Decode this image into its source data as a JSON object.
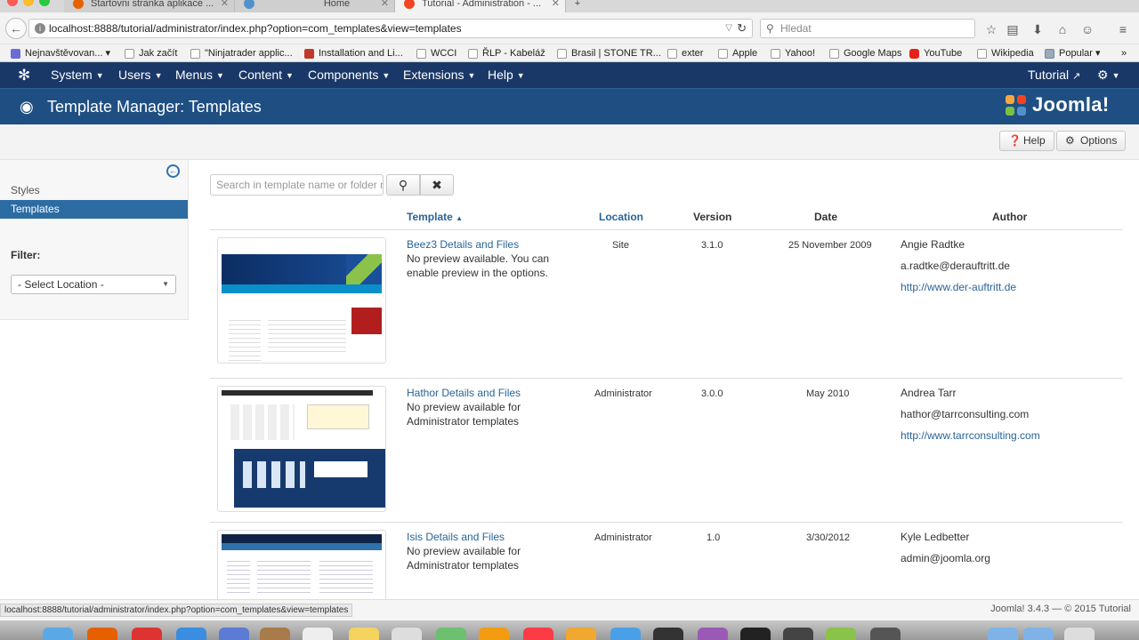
{
  "browser": {
    "tabs": [
      {
        "label": "Startovni stranka aplikace ...",
        "active": false
      },
      {
        "label": "Home",
        "active": false
      },
      {
        "label": "Tutorial - Administration - ...",
        "active": true
      }
    ],
    "url": "localhost:8888/tutorial/administrator/index.php?option=com_templates&view=templates",
    "search_placeholder": "Hledat",
    "bookmarks": [
      "Nejnavštěvovan...",
      "Jak začít",
      "\"Ninjatrader applic...",
      "Installation and Li...",
      "WCCI",
      "ŘLP - Kabeláž",
      "Brasil | STONE TR...",
      "exter",
      "Apple",
      "Yahoo!",
      "Google Maps",
      "YouTube",
      "Wikipedia",
      "Popular"
    ]
  },
  "nav": {
    "items": [
      "System",
      "Users",
      "Menus",
      "Content",
      "Components",
      "Extensions",
      "Help"
    ],
    "site_link": "Tutorial"
  },
  "header": {
    "title": "Template Manager: Templates",
    "brand": "Joomla!"
  },
  "toolbar": {
    "help_label": "Help",
    "options_label": "Options"
  },
  "sidebar": {
    "items": [
      "Styles",
      "Templates"
    ],
    "filter_label": "Filter:",
    "location_select": "- Select Location -"
  },
  "search": {
    "placeholder": "Search in template name or folder name"
  },
  "table": {
    "columns": {
      "template": "Template",
      "location": "Location",
      "version": "Version",
      "date": "Date",
      "author": "Author"
    },
    "rows": [
      {
        "name": "Beez3 Details and Files",
        "desc": "No preview available. You can enable preview in the options.",
        "location": "Site",
        "version": "3.1.0",
        "date": "25 November 2009",
        "author": "Angie Radtke",
        "email": "a.radtke@derauftritt.de",
        "url": "http://www.der-auftritt.de"
      },
      {
        "name": "Hathor Details and Files",
        "desc": "No preview available for Administrator templates",
        "location": "Administrator",
        "version": "3.0.0",
        "date": "May 2010",
        "author": "Andrea Tarr",
        "email": "hathor@tarrconsulting.com",
        "url": "http://www.tarrconsulting.com"
      },
      {
        "name": "Isis Details and Files",
        "desc": "No preview available for Administrator templates",
        "location": "Administrator",
        "version": "1.0",
        "date": "3/30/2012",
        "author": "Kyle Ledbetter",
        "email": "admin@joomla.org",
        "url": ""
      }
    ]
  },
  "footer": {
    "status_url": "localhost:8888/tutorial/administrator/index.php?option=com_templates&view=templates",
    "version": "Joomla! 3.4.3 — © 2015 Tutorial"
  },
  "colors": {
    "nav_bg": "#1a3867",
    "header_bg": "#1f4f82",
    "active_item": "#2d6ca2",
    "link": "#2a6496"
  }
}
